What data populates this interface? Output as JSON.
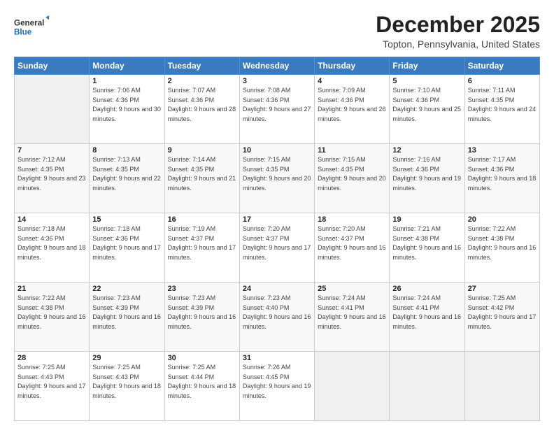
{
  "header": {
    "logo_line1": "General",
    "logo_line2": "Blue",
    "title": "December 2025",
    "subtitle": "Topton, Pennsylvania, United States"
  },
  "weekdays": [
    "Sunday",
    "Monday",
    "Tuesday",
    "Wednesday",
    "Thursday",
    "Friday",
    "Saturday"
  ],
  "weeks": [
    [
      {
        "day": "",
        "empty": true
      },
      {
        "day": "1",
        "sunrise": "7:06 AM",
        "sunset": "4:36 PM",
        "daylight": "9 hours and 30 minutes."
      },
      {
        "day": "2",
        "sunrise": "7:07 AM",
        "sunset": "4:36 PM",
        "daylight": "9 hours and 28 minutes."
      },
      {
        "day": "3",
        "sunrise": "7:08 AM",
        "sunset": "4:36 PM",
        "daylight": "9 hours and 27 minutes."
      },
      {
        "day": "4",
        "sunrise": "7:09 AM",
        "sunset": "4:36 PM",
        "daylight": "9 hours and 26 minutes."
      },
      {
        "day": "5",
        "sunrise": "7:10 AM",
        "sunset": "4:36 PM",
        "daylight": "9 hours and 25 minutes."
      },
      {
        "day": "6",
        "sunrise": "7:11 AM",
        "sunset": "4:35 PM",
        "daylight": "9 hours and 24 minutes."
      }
    ],
    [
      {
        "day": "7",
        "sunrise": "7:12 AM",
        "sunset": "4:35 PM",
        "daylight": "9 hours and 23 minutes."
      },
      {
        "day": "8",
        "sunrise": "7:13 AM",
        "sunset": "4:35 PM",
        "daylight": "9 hours and 22 minutes."
      },
      {
        "day": "9",
        "sunrise": "7:14 AM",
        "sunset": "4:35 PM",
        "daylight": "9 hours and 21 minutes."
      },
      {
        "day": "10",
        "sunrise": "7:15 AM",
        "sunset": "4:35 PM",
        "daylight": "9 hours and 20 minutes."
      },
      {
        "day": "11",
        "sunrise": "7:15 AM",
        "sunset": "4:35 PM",
        "daylight": "9 hours and 20 minutes."
      },
      {
        "day": "12",
        "sunrise": "7:16 AM",
        "sunset": "4:36 PM",
        "daylight": "9 hours and 19 minutes."
      },
      {
        "day": "13",
        "sunrise": "7:17 AM",
        "sunset": "4:36 PM",
        "daylight": "9 hours and 18 minutes."
      }
    ],
    [
      {
        "day": "14",
        "sunrise": "7:18 AM",
        "sunset": "4:36 PM",
        "daylight": "9 hours and 18 minutes."
      },
      {
        "day": "15",
        "sunrise": "7:18 AM",
        "sunset": "4:36 PM",
        "daylight": "9 hours and 17 minutes."
      },
      {
        "day": "16",
        "sunrise": "7:19 AM",
        "sunset": "4:37 PM",
        "daylight": "9 hours and 17 minutes."
      },
      {
        "day": "17",
        "sunrise": "7:20 AM",
        "sunset": "4:37 PM",
        "daylight": "9 hours and 17 minutes."
      },
      {
        "day": "18",
        "sunrise": "7:20 AM",
        "sunset": "4:37 PM",
        "daylight": "9 hours and 16 minutes."
      },
      {
        "day": "19",
        "sunrise": "7:21 AM",
        "sunset": "4:38 PM",
        "daylight": "9 hours and 16 minutes."
      },
      {
        "day": "20",
        "sunrise": "7:22 AM",
        "sunset": "4:38 PM",
        "daylight": "9 hours and 16 minutes."
      }
    ],
    [
      {
        "day": "21",
        "sunrise": "7:22 AM",
        "sunset": "4:38 PM",
        "daylight": "9 hours and 16 minutes."
      },
      {
        "day": "22",
        "sunrise": "7:23 AM",
        "sunset": "4:39 PM",
        "daylight": "9 hours and 16 minutes."
      },
      {
        "day": "23",
        "sunrise": "7:23 AM",
        "sunset": "4:39 PM",
        "daylight": "9 hours and 16 minutes."
      },
      {
        "day": "24",
        "sunrise": "7:23 AM",
        "sunset": "4:40 PM",
        "daylight": "9 hours and 16 minutes."
      },
      {
        "day": "25",
        "sunrise": "7:24 AM",
        "sunset": "4:41 PM",
        "daylight": "9 hours and 16 minutes."
      },
      {
        "day": "26",
        "sunrise": "7:24 AM",
        "sunset": "4:41 PM",
        "daylight": "9 hours and 16 minutes."
      },
      {
        "day": "27",
        "sunrise": "7:25 AM",
        "sunset": "4:42 PM",
        "daylight": "9 hours and 17 minutes."
      }
    ],
    [
      {
        "day": "28",
        "sunrise": "7:25 AM",
        "sunset": "4:43 PM",
        "daylight": "9 hours and 17 minutes."
      },
      {
        "day": "29",
        "sunrise": "7:25 AM",
        "sunset": "4:43 PM",
        "daylight": "9 hours and 18 minutes."
      },
      {
        "day": "30",
        "sunrise": "7:25 AM",
        "sunset": "4:44 PM",
        "daylight": "9 hours and 18 minutes."
      },
      {
        "day": "31",
        "sunrise": "7:26 AM",
        "sunset": "4:45 PM",
        "daylight": "9 hours and 19 minutes."
      },
      {
        "day": "",
        "empty": true
      },
      {
        "day": "",
        "empty": true
      },
      {
        "day": "",
        "empty": true
      }
    ]
  ]
}
